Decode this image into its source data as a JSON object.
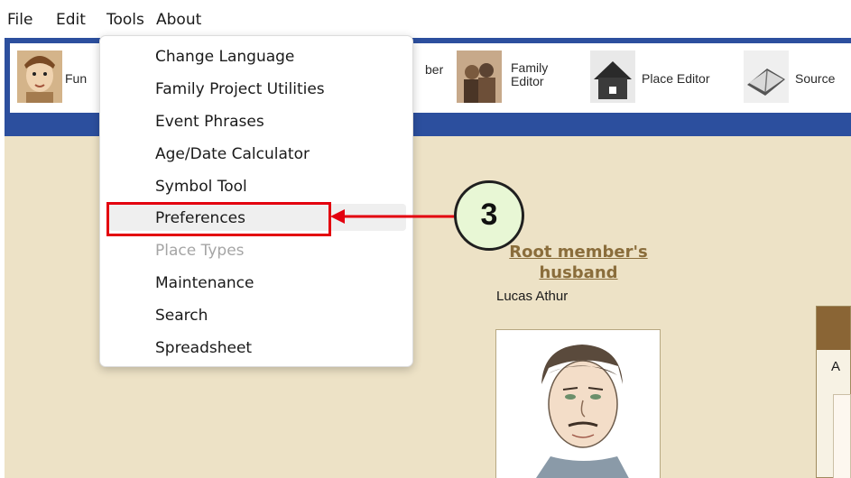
{
  "menubar": {
    "items": [
      "File",
      "Edit",
      "Tools",
      "About"
    ]
  },
  "toolbar": {
    "items": [
      {
        "label": "Fun",
        "icon": "cartoon-person-icon"
      },
      {
        "label": "ber",
        "icon": "member-icon"
      },
      {
        "label": "Family\nEditor",
        "icon": "family-photo-icon"
      },
      {
        "label": "Place Editor",
        "icon": "house-icon"
      },
      {
        "label": "Source",
        "icon": "book-icon"
      }
    ]
  },
  "tools_menu": {
    "items": [
      {
        "label": "Change Language",
        "enabled": true
      },
      {
        "label": "Family Project Utilities",
        "enabled": true
      },
      {
        "label": "Event Phrases",
        "enabled": true
      },
      {
        "label": "Age/Date Calculator",
        "enabled": true
      },
      {
        "label": "Symbol Tool",
        "enabled": true
      },
      {
        "label": "Preferences",
        "enabled": true,
        "highlighted": true
      },
      {
        "label": "Place Types",
        "enabled": false
      },
      {
        "label": "Maintenance",
        "enabled": true
      },
      {
        "label": "Search",
        "enabled": true
      },
      {
        "label": "Spreadsheet",
        "enabled": true
      }
    ]
  },
  "member": {
    "title": "Root member's husband",
    "name": "Lucas Athur"
  },
  "right_card": {
    "label": "A"
  },
  "annotation": {
    "step": "3",
    "color": "#e3000f"
  },
  "colors": {
    "frame": "#2c4f9e",
    "content": "#ede2c6",
    "title": "#8a6d3b"
  }
}
